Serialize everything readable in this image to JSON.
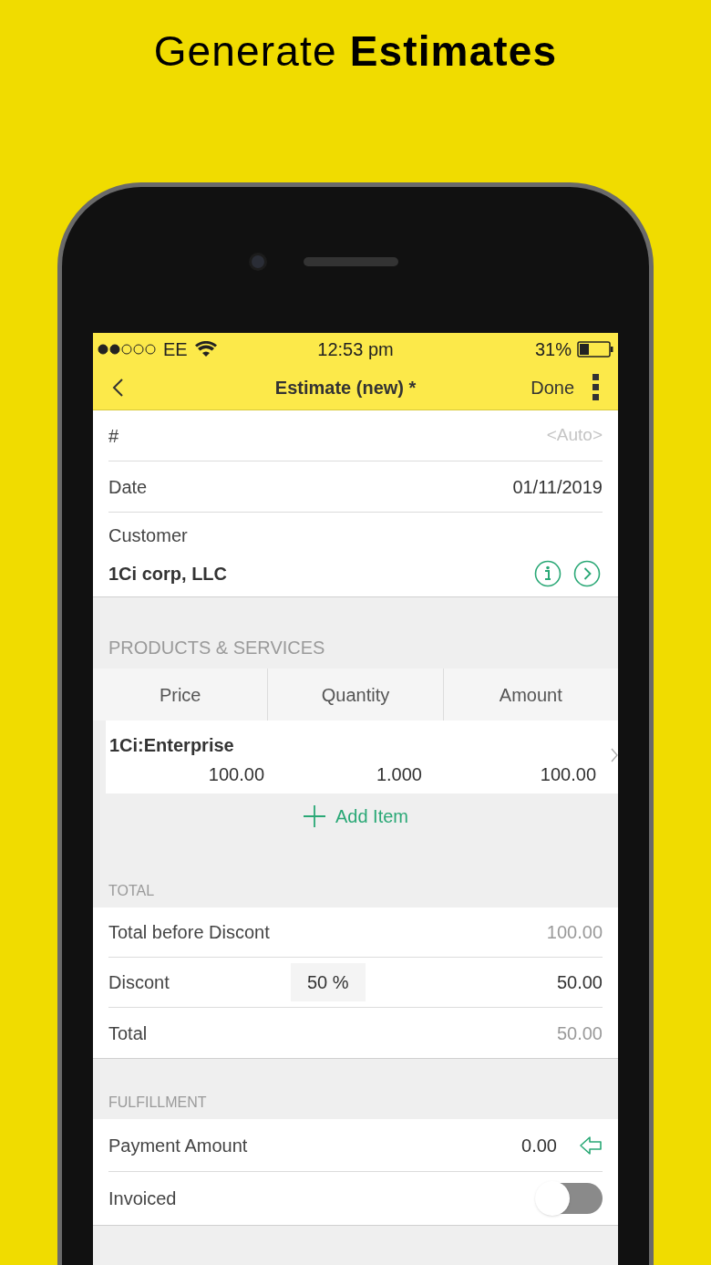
{
  "headline": "Generate **Estimates**",
  "status_bar": {
    "carrier": "EE",
    "time": "12:53 pm",
    "battery": "31%"
  },
  "nav": {
    "title": "Estimate (new) *",
    "done": "Done"
  },
  "fields": [
    {
      "label": "#",
      "placeholder": "<Auto>"
    },
    {
      "label": "Date",
      "value": "01/11/2019"
    }
  ],
  "customer": {
    "label": "Customer",
    "value": "1Ci corp, LLC"
  },
  "products": {
    "heading": "PRODUCTS & SERVICES",
    "columns": [
      "Price",
      "Quantity",
      "Amount"
    ],
    "items": [
      {
        "name": "1Ci:Enterprise",
        "price": "100.00",
        "quantity": "1.000",
        "amount": "100.00"
      }
    ],
    "add": "Add Item"
  },
  "total": {
    "heading": "TOTAL",
    "rows": [
      {
        "kind": "readonly",
        "label": "Total before Discont",
        "value": "100.00"
      },
      {
        "kind": "discount",
        "label": "Discont",
        "percent": "50 %",
        "value": "50.00"
      },
      {
        "kind": "readonly",
        "label": "Total",
        "value": "50.00"
      }
    ]
  },
  "fulfillment": {
    "heading": "FULFILLMENT",
    "rows": [
      {
        "kind": "amount",
        "label": "Payment Amount",
        "value": "0.00"
      },
      {
        "kind": "toggle",
        "label": "Invoiced",
        "on": false
      }
    ]
  }
}
